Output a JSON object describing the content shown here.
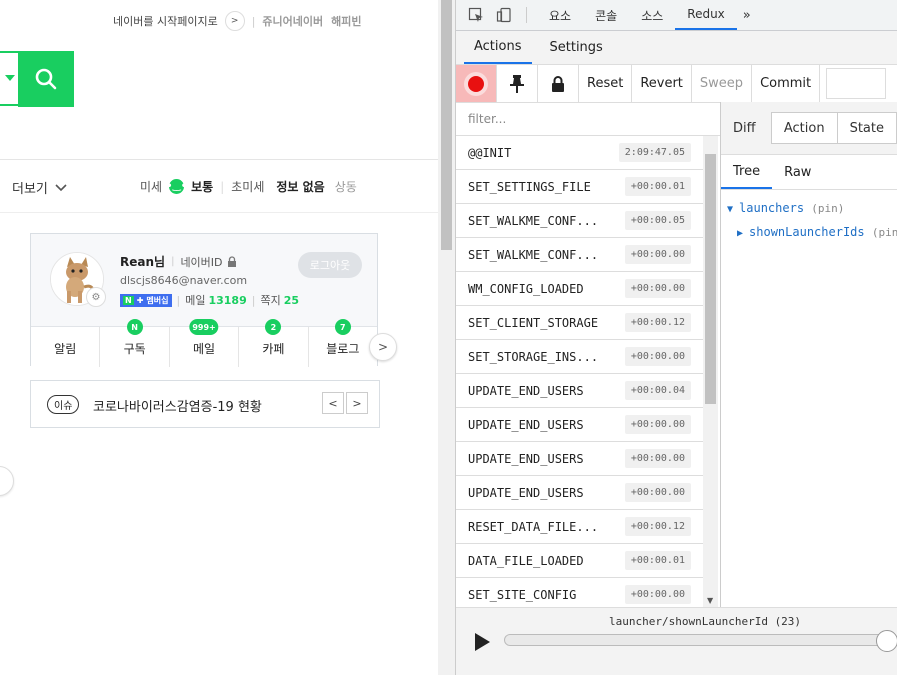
{
  "naver": {
    "top_links": {
      "start_page": "네이버를 시작페이지로",
      "junior": "쥬니어네이버",
      "happybean": "해피빈"
    },
    "nav": {
      "more_label": "더보기"
    },
    "weather": {
      "fine_dust_label": "미세",
      "fine_dust_value": "보통",
      "ultra_fine_label": "초미세",
      "ultra_fine_value": "정보 없음",
      "extra": "상동"
    },
    "profile": {
      "name": "Rean님",
      "id_label": "네이버ID",
      "email": "dlscjs8646@naver.com",
      "membership_badge": "멤버십",
      "mail_label": "메일",
      "mail_count": "13189",
      "note_label": "쪽지",
      "note_count": "25",
      "logout_label": "로그아웃",
      "tabs": [
        {
          "label": "알림",
          "badge": ""
        },
        {
          "label": "구독",
          "badge": "N"
        },
        {
          "label": "메일",
          "badge": "999+"
        },
        {
          "label": "카페",
          "badge": "2"
        },
        {
          "label": "블로그",
          "badge": "7"
        }
      ]
    },
    "issue": {
      "tag": "이슈",
      "text": "코로나바이러스감염증-19 현황"
    }
  },
  "devtools": {
    "tabs": [
      "요소",
      "콘솔",
      "소스",
      "Redux"
    ],
    "active_tab": "Redux",
    "redux_tabs": [
      "Actions",
      "Settings"
    ],
    "toolbar": {
      "reset": "Reset",
      "revert": "Revert",
      "sweep": "Sweep",
      "commit": "Commit"
    },
    "filter_placeholder": "filter...",
    "actions": [
      {
        "name": "@@INIT",
        "time": "2:09:47.05"
      },
      {
        "name": "SET_SETTINGS_FILE",
        "time": "+00:00.01"
      },
      {
        "name": "SET_WALKME_CONF...",
        "time": "+00:00.05"
      },
      {
        "name": "SET_WALKME_CONF...",
        "time": "+00:00.00"
      },
      {
        "name": "WM_CONFIG_LOADED",
        "time": "+00:00.00"
      },
      {
        "name": "SET_CLIENT_STORAGE",
        "time": "+00:00.12"
      },
      {
        "name": "SET_STORAGE_INS...",
        "time": "+00:00.00"
      },
      {
        "name": "UPDATE_END_USERS",
        "time": "+00:00.04"
      },
      {
        "name": "UPDATE_END_USERS",
        "time": "+00:00.00"
      },
      {
        "name": "UPDATE_END_USERS",
        "time": "+00:00.00"
      },
      {
        "name": "UPDATE_END_USERS",
        "time": "+00:00.00"
      },
      {
        "name": "RESET_DATA_FILE...",
        "time": "+00:00.12"
      },
      {
        "name": "DATA_FILE_LOADED",
        "time": "+00:00.01"
      },
      {
        "name": "SET_SITE_CONFIG",
        "time": "+00:00.00"
      }
    ],
    "monitor": {
      "diff_label": "Diff",
      "segments": [
        "Action",
        "State"
      ],
      "view_tabs": [
        "Tree",
        "Raw"
      ],
      "tree": [
        {
          "key": "launchers",
          "meta": "(pin)"
        },
        {
          "key": "shownLauncherIds",
          "meta": "(pin)"
        }
      ]
    },
    "slider": {
      "label": "launcher/shownLauncherId (23)",
      "position_fraction": 0.98
    }
  },
  "colors": {
    "naver_green": "#19ce60",
    "devtools_accent": "#1a73e8",
    "record_red": "#e81010"
  }
}
